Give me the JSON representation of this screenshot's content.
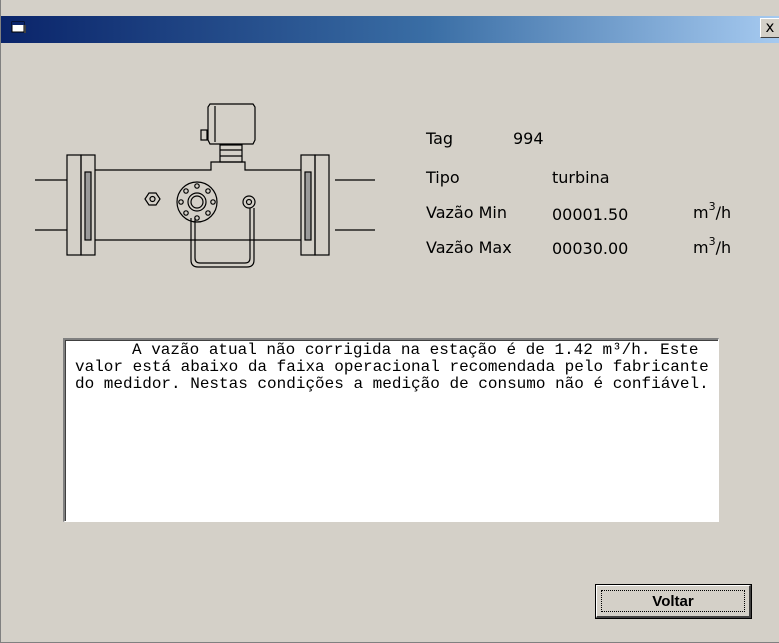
{
  "titlebar": {
    "close_label": "x"
  },
  "meter": {
    "tag_label": "Tag",
    "tag_value": "994",
    "type_label": "Tipo",
    "type_value": "turbina",
    "min_label": "Vazão Min",
    "min_value": "00001.50",
    "max_label": "Vazão Max",
    "max_value": "00030.00",
    "unit_base": "m",
    "unit_exp": "3",
    "unit_tail": "/h"
  },
  "message": "A vazão atual não corrigida na estação é de 1.42 m³/h.  Este valor está abaixo da faixa operacional recomendada pelo fabricante do medidor.  Nestas condições a medição de consumo não é confiável.",
  "buttons": {
    "back_label": "Voltar"
  },
  "colors": {
    "title_start": "#0a246a",
    "title_end": "#a6caf0",
    "window_bg": "#d4d0c8"
  },
  "icons": {
    "title": "window-icon",
    "meter": "turbine-meter-drawing"
  }
}
